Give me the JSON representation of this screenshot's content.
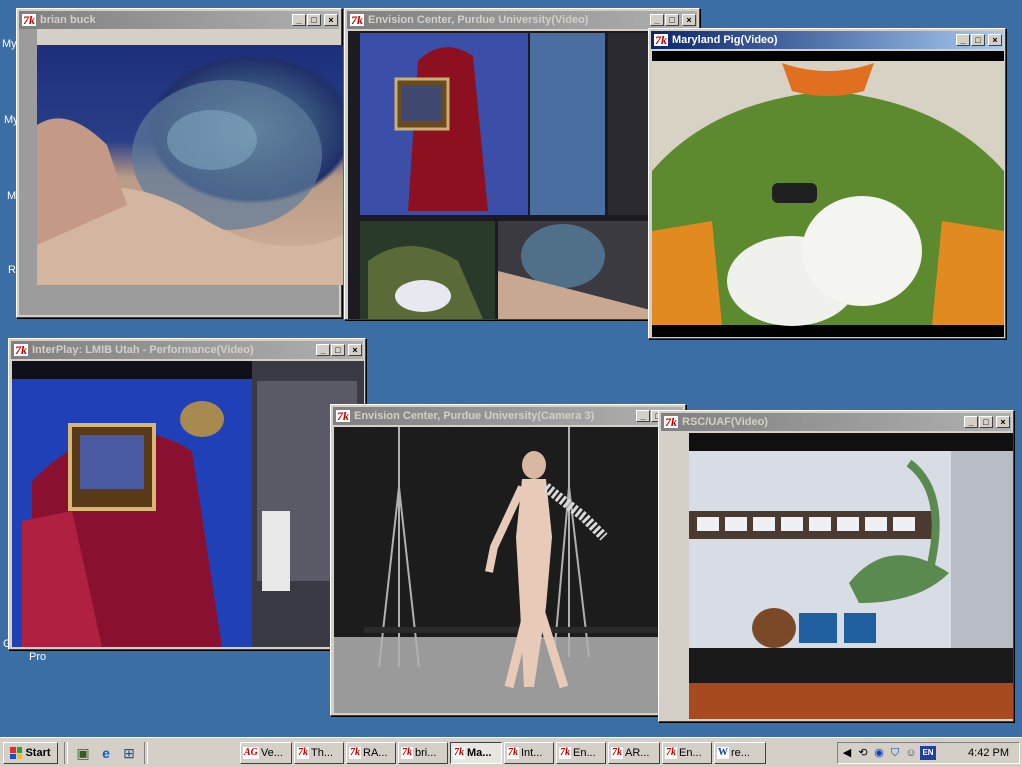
{
  "desktop": {
    "labels": [
      "My",
      "My",
      "M",
      "R",
      "G",
      "Pro"
    ]
  },
  "windows": [
    {
      "title": "brian buck",
      "icon": "7k"
    },
    {
      "title": "Envision Center, Purdue University(Video)",
      "icon": "7k"
    },
    {
      "title": "Maryland Pig(Video)",
      "icon": "7k"
    },
    {
      "title": "InterPlay: LMIB Utah - Performance(Video)",
      "icon": "7k"
    },
    {
      "title": "Envision Center, Purdue University(Camera 3)",
      "icon": "7k"
    },
    {
      "title": "RSC/UAF(Video)",
      "icon": "7k"
    }
  ],
  "window_buttons": {
    "minimize": "_",
    "maximize": "□",
    "close": "×"
  },
  "taskbar": {
    "start_label": "Start",
    "quick_launch": [
      "desktop-icon",
      "ie-icon",
      "network-icon"
    ],
    "buttons": [
      {
        "prefix": "AG",
        "label": "Ve..."
      },
      {
        "prefix": "7k",
        "label": "Th..."
      },
      {
        "prefix": "7k",
        "label": "RA..."
      },
      {
        "prefix": "7k",
        "label": "bri..."
      },
      {
        "prefix": "7k",
        "label": "Ma..."
      },
      {
        "prefix": "7k",
        "label": "Int..."
      },
      {
        "prefix": "7k",
        "label": "En..."
      },
      {
        "prefix": "7k",
        "label": "AR..."
      },
      {
        "prefix": "7k",
        "label": "En..."
      },
      {
        "prefix": "W",
        "label": "re..."
      }
    ],
    "tray": {
      "language": "EN",
      "clock": "4:42 PM"
    }
  }
}
